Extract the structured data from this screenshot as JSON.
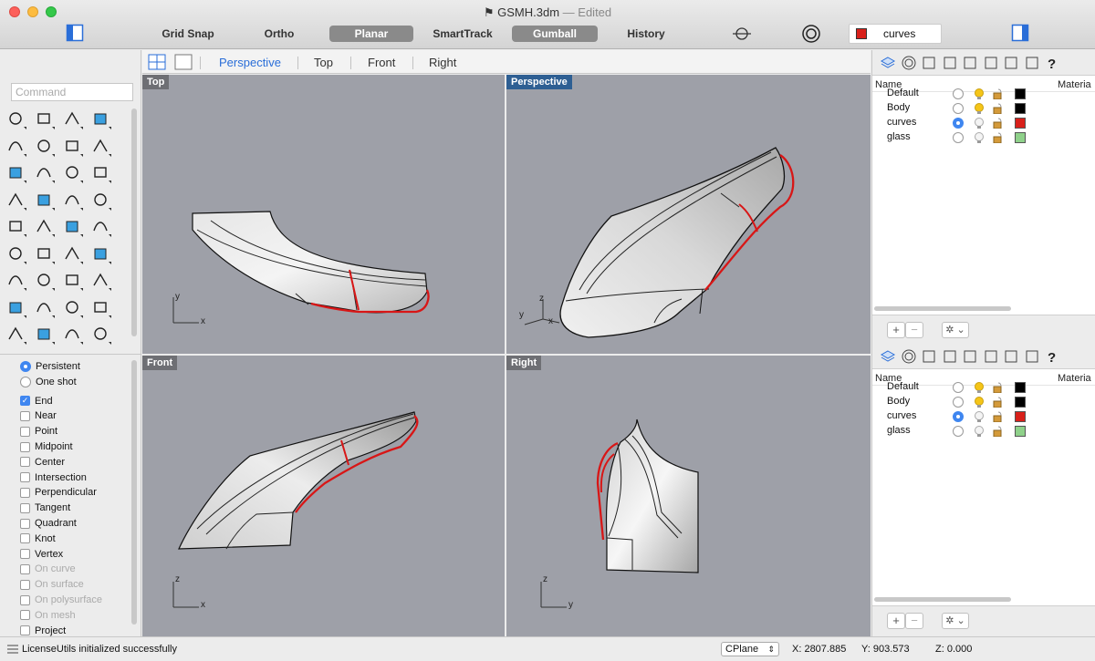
{
  "titlebar": {
    "document": "GSMH.3dm",
    "separator": "—",
    "state": "Edited",
    "buttons": [
      {
        "label": "Grid Snap",
        "active": false
      },
      {
        "label": "Ortho",
        "active": false
      },
      {
        "label": "Planar",
        "active": true
      },
      {
        "label": "SmartTrack",
        "active": false
      },
      {
        "label": "Gumball",
        "active": true
      },
      {
        "label": "History",
        "active": false
      }
    ],
    "current_layer": "curves",
    "current_layer_color": "#d8201a"
  },
  "left": {
    "command_placeholder": "Command",
    "osnap_modes": [
      {
        "label": "Persistent",
        "kind": "radio",
        "checked": true,
        "enabled": true
      },
      {
        "label": "One shot",
        "kind": "radio",
        "checked": false,
        "enabled": true
      },
      {
        "label": "End",
        "kind": "check",
        "checked": true,
        "enabled": true
      },
      {
        "label": "Near",
        "kind": "check",
        "checked": false,
        "enabled": true
      },
      {
        "label": "Point",
        "kind": "check",
        "checked": false,
        "enabled": true
      },
      {
        "label": "Midpoint",
        "kind": "check",
        "checked": false,
        "enabled": true
      },
      {
        "label": "Center",
        "kind": "check",
        "checked": false,
        "enabled": true
      },
      {
        "label": "Intersection",
        "kind": "check",
        "checked": false,
        "enabled": true
      },
      {
        "label": "Perpendicular",
        "kind": "check",
        "checked": false,
        "enabled": true
      },
      {
        "label": "Tangent",
        "kind": "check",
        "checked": false,
        "enabled": true
      },
      {
        "label": "Quadrant",
        "kind": "check",
        "checked": false,
        "enabled": true
      },
      {
        "label": "Knot",
        "kind": "check",
        "checked": false,
        "enabled": true
      },
      {
        "label": "Vertex",
        "kind": "check",
        "checked": false,
        "enabled": true
      },
      {
        "label": "On curve",
        "kind": "check",
        "checked": false,
        "enabled": false
      },
      {
        "label": "On surface",
        "kind": "check",
        "checked": false,
        "enabled": false
      },
      {
        "label": "On polysurface",
        "kind": "check",
        "checked": false,
        "enabled": false
      },
      {
        "label": "On mesh",
        "kind": "check",
        "checked": false,
        "enabled": false
      },
      {
        "label": "Project",
        "kind": "check",
        "checked": false,
        "enabled": true
      }
    ]
  },
  "viewport_tabs": [
    "Perspective",
    "Top",
    "Front",
    "Right"
  ],
  "active_viewport": "Perspective",
  "viewports": {
    "top": {
      "label": "Top",
      "axes": [
        "y",
        "x"
      ]
    },
    "perspective": {
      "label": "Perspective",
      "axes": [
        "z",
        "y",
        "x"
      ]
    },
    "front": {
      "label": "Front",
      "axes": [
        "z",
        "x"
      ]
    },
    "right": {
      "label": "Right",
      "axes": [
        "z",
        "y"
      ]
    }
  },
  "layers": {
    "header_name": "Name",
    "header_material": "Materia",
    "items": [
      {
        "name": "Default",
        "current": false,
        "color": "#000000"
      },
      {
        "name": "Body",
        "current": false,
        "color": "#000000"
      },
      {
        "name": "curves",
        "current": true,
        "color": "#d8201a"
      },
      {
        "name": "glass",
        "current": false,
        "color": "#8fd18a"
      }
    ],
    "add_label": "+",
    "remove_label": "−",
    "gear_label": "✲ ⌄"
  },
  "status": {
    "message": "LicenseUtils initialized successfully",
    "cplane": "CPlane",
    "x": "X: 2807.885",
    "y": "Y: 903.573",
    "z": "Z: 0.000"
  }
}
